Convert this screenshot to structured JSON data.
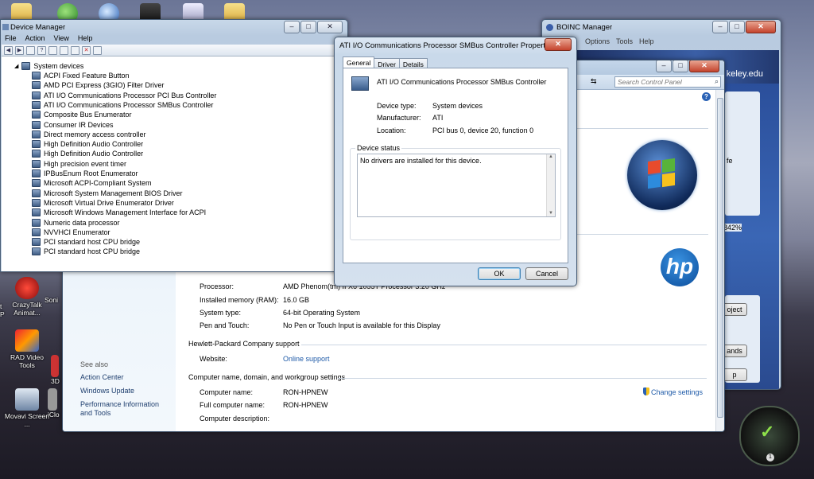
{
  "desktop": {
    "icons": [
      {
        "label": "CrazyTalk Animat..."
      },
      {
        "label": "RAD Video Tools"
      },
      {
        "label": "Movavi Screen ..."
      },
      {
        "label": "Soni"
      },
      {
        "label": "3D"
      },
      {
        "label": "iClo"
      }
    ],
    "left_edge_text": "t",
    "left_edge_text2": "P"
  },
  "device_manager": {
    "title": "Device Manager",
    "menu": [
      "File",
      "Action",
      "View",
      "Help"
    ],
    "category": "System devices",
    "devices": [
      "ACPI Fixed Feature Button",
      "AMD PCI Express (3GIO) Filter Driver",
      "ATI I/O Communications Processor PCI Bus Controller",
      "ATI I/O Communications Processor SMBus Controller",
      "Composite Bus Enumerator",
      "Consumer IR Devices",
      "Direct memory access controller",
      "High Definition Audio Controller",
      "High Definition Audio Controller",
      "High precision event timer",
      "IPBusEnum Root Enumerator",
      "Microsoft ACPI-Compliant System",
      "Microsoft System Management BIOS Driver",
      "Microsoft Virtual Drive Enumerator Driver",
      "Microsoft Windows Management Interface for ACPI",
      "Numeric data processor",
      "NVVHCI Enumerator",
      "PCI standard host CPU bridge",
      "PCI standard host CPU bridge"
    ]
  },
  "boinc": {
    "title": "BOINC Manager",
    "menu": [
      "Options",
      "Tools",
      "Help"
    ],
    "url_fragment": "keley.edu",
    "side_texts": [
      "fe",
      "842%",
      "oject",
      "ands",
      "p"
    ]
  },
  "control_panel": {
    "search_placeholder": "Search Control Panel",
    "system": {
      "processor_label": "Processor:",
      "processor_value": "AMD Phenom(tm) II X6 1055T Processor   3.20 GHz",
      "ram_label": "Installed memory (RAM):",
      "ram_value": "16.0 GB",
      "type_label": "System type:",
      "type_value": "64-bit Operating System",
      "pen_label": "Pen and Touch:",
      "pen_value": "No Pen or Touch Input is available for this Display"
    },
    "support_header": "Hewlett-Packard Company support",
    "website_label": "Website:",
    "website_value": "Online support",
    "name_header": "Computer name, domain, and workgroup settings",
    "computer_name_label": "Computer name:",
    "computer_name_value": "RON-HPNEW",
    "full_name_label": "Full computer name:",
    "full_name_value": "RON-HPNEW",
    "description_label": "Computer description:",
    "change_settings": "Change settings",
    "see_also": "See also",
    "see_also_links": [
      "Action Center",
      "Windows Update",
      "Performance Information and Tools"
    ]
  },
  "dialog": {
    "title": "ATI I/O Communications Processor SMBus Controller Properties",
    "tabs": [
      "General",
      "Driver",
      "Details"
    ],
    "device_name": "ATI I/O Communications Processor SMBus Controller",
    "type_label": "Device type:",
    "type_value": "System devices",
    "manufacturer_label": "Manufacturer:",
    "manufacturer_value": "ATI",
    "location_label": "Location:",
    "location_value": "PCI bus 0, device 20, function 0",
    "status_group": "Device status",
    "status_text": "No drivers are installed for this device.",
    "ok": "OK",
    "cancel": "Cancel"
  },
  "gadget": {
    "count": "1"
  },
  "colors": {
    "link": "#1e5aa8",
    "title_bar": "#c9d9ea",
    "close_button": "#c4432d"
  }
}
